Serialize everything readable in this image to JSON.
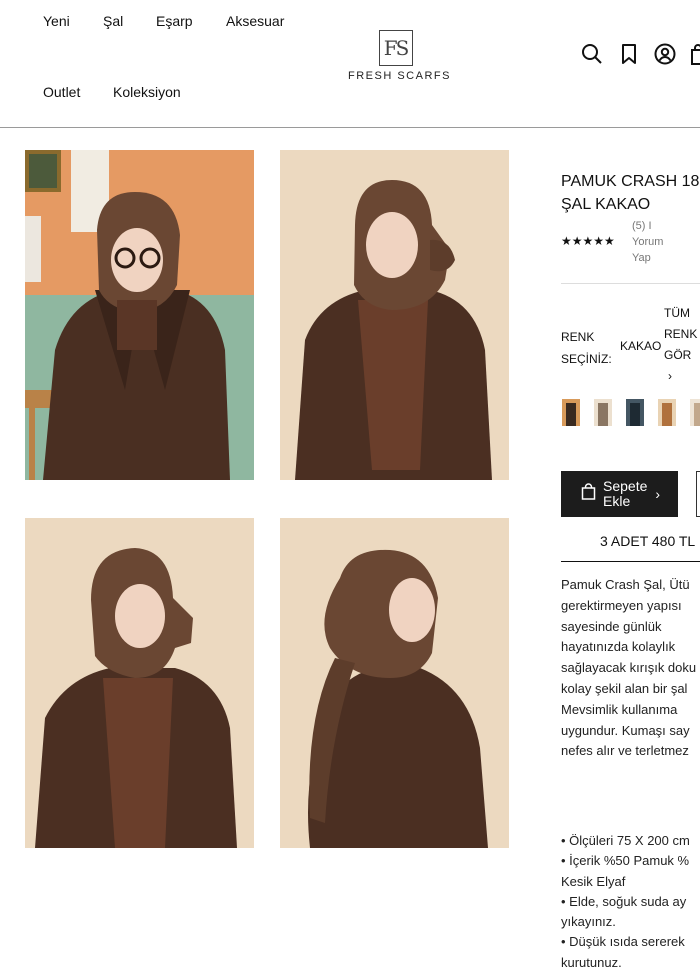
{
  "header": {
    "nav": [
      "Yeni",
      "Şal",
      "Eşarp",
      "Aksesuar",
      "Outlet",
      "Koleksiyon"
    ],
    "logo_mark": "FS",
    "logo_text": "FRESH SCARFS",
    "icons": [
      "search-icon",
      "bookmark-icon",
      "user-icon",
      "bag-icon"
    ]
  },
  "product": {
    "title_line1": "PAMUK CRASH 18",
    "title_line2": "ŞAL KAKAO",
    "rating": "★★★★★",
    "review_count": "(5) I",
    "review_link_1": "Yorum",
    "review_link_2": "Yap",
    "renk_label_1": "RENK",
    "renk_label_2": "SEÇİNİZ:",
    "renk_value": "KAKAO",
    "tum_1": "TÜM",
    "tum_2": "RENK",
    "tum_3": "GÖR",
    "tum_arrow": "›",
    "cart_label_1": "Sepete",
    "cart_label_2": "Ekle",
    "cart_chevron": "›",
    "promo": "3 ADET 480 TL",
    "desc": [
      "Pamuk Crash Şal, Ütü",
      "gerektirmeyen yapısı",
      "sayesinde günlük",
      "hayatınızda kolaylık",
      "sağlayacak kırışık doku",
      "kolay şekil alan bir şal",
      "Mevsimlik kullanıma",
      "uygundur. Kumaşı say",
      "nefes alır ve terletmez"
    ],
    "bullets": [
      "• Ölçüleri 75 X 200 cm",
      "• İçerik %50 Pamuk %",
      "Kesik Elyaf",
      "• Elde, soğuk suda ay",
      "yıkayınız.",
      "• Düşük ısıda sererek",
      "kurutunuz."
    ]
  },
  "colors": {
    "accent_dark": "#1c1c1c",
    "scarf_brown": "#5d4130"
  }
}
